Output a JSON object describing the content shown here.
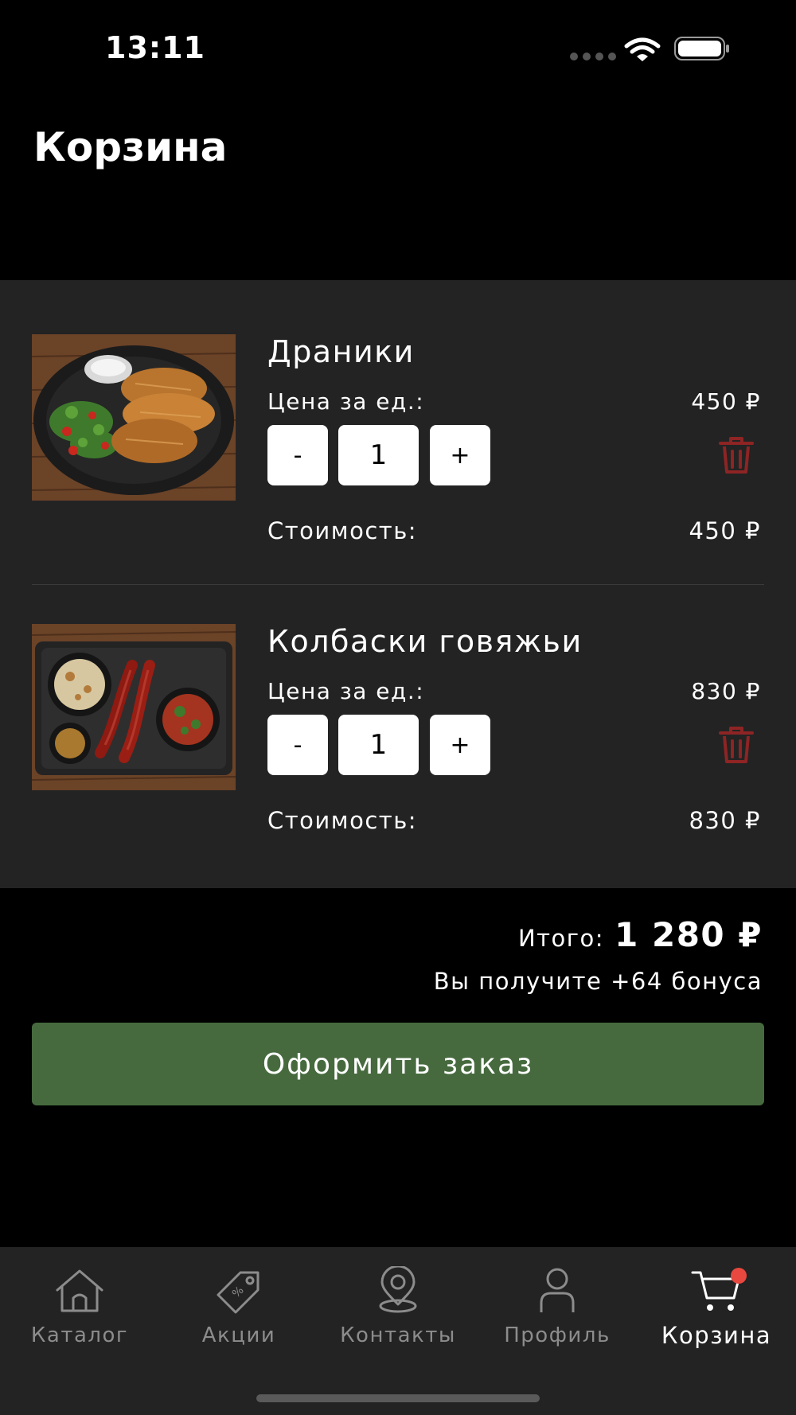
{
  "status_bar": {
    "time": "13:11"
  },
  "page": {
    "title": "Корзина"
  },
  "cart": {
    "items": [
      {
        "name": "Драники",
        "unit_price_label": "Цена за ед.:",
        "unit_price": "450 ₽",
        "qty_minus": "-",
        "quantity": "1",
        "qty_plus": "+",
        "cost_label": "Стоимость:",
        "cost": "450 ₽"
      },
      {
        "name": "Колбаски говяжьи",
        "unit_price_label": "Цена за ед.:",
        "unit_price": "830 ₽",
        "qty_minus": "-",
        "quantity": "1",
        "qty_plus": "+",
        "cost_label": "Стоимость:",
        "cost": "830 ₽"
      }
    ]
  },
  "summary": {
    "total_label": "Итого:",
    "total_value": "1 280 ₽",
    "bonus_text": "Вы получите +64 бонуса",
    "checkout_label": "Оформить заказ"
  },
  "tab_bar": {
    "tabs": [
      {
        "label": "Каталог",
        "icon": "home-icon"
      },
      {
        "label": "Акции",
        "icon": "discount-tag-icon"
      },
      {
        "label": "Контакты",
        "icon": "location-pin-icon"
      },
      {
        "label": "Профиль",
        "icon": "person-icon"
      },
      {
        "label": "Корзина",
        "icon": "cart-icon",
        "active": true
      }
    ]
  },
  "colors": {
    "background": "#000000",
    "panel": "#232323",
    "accent_green": "#466a3e",
    "trash_red": "#8e2424",
    "badge_red": "#e8483f",
    "inactive_tab": "#8c8c8c"
  }
}
